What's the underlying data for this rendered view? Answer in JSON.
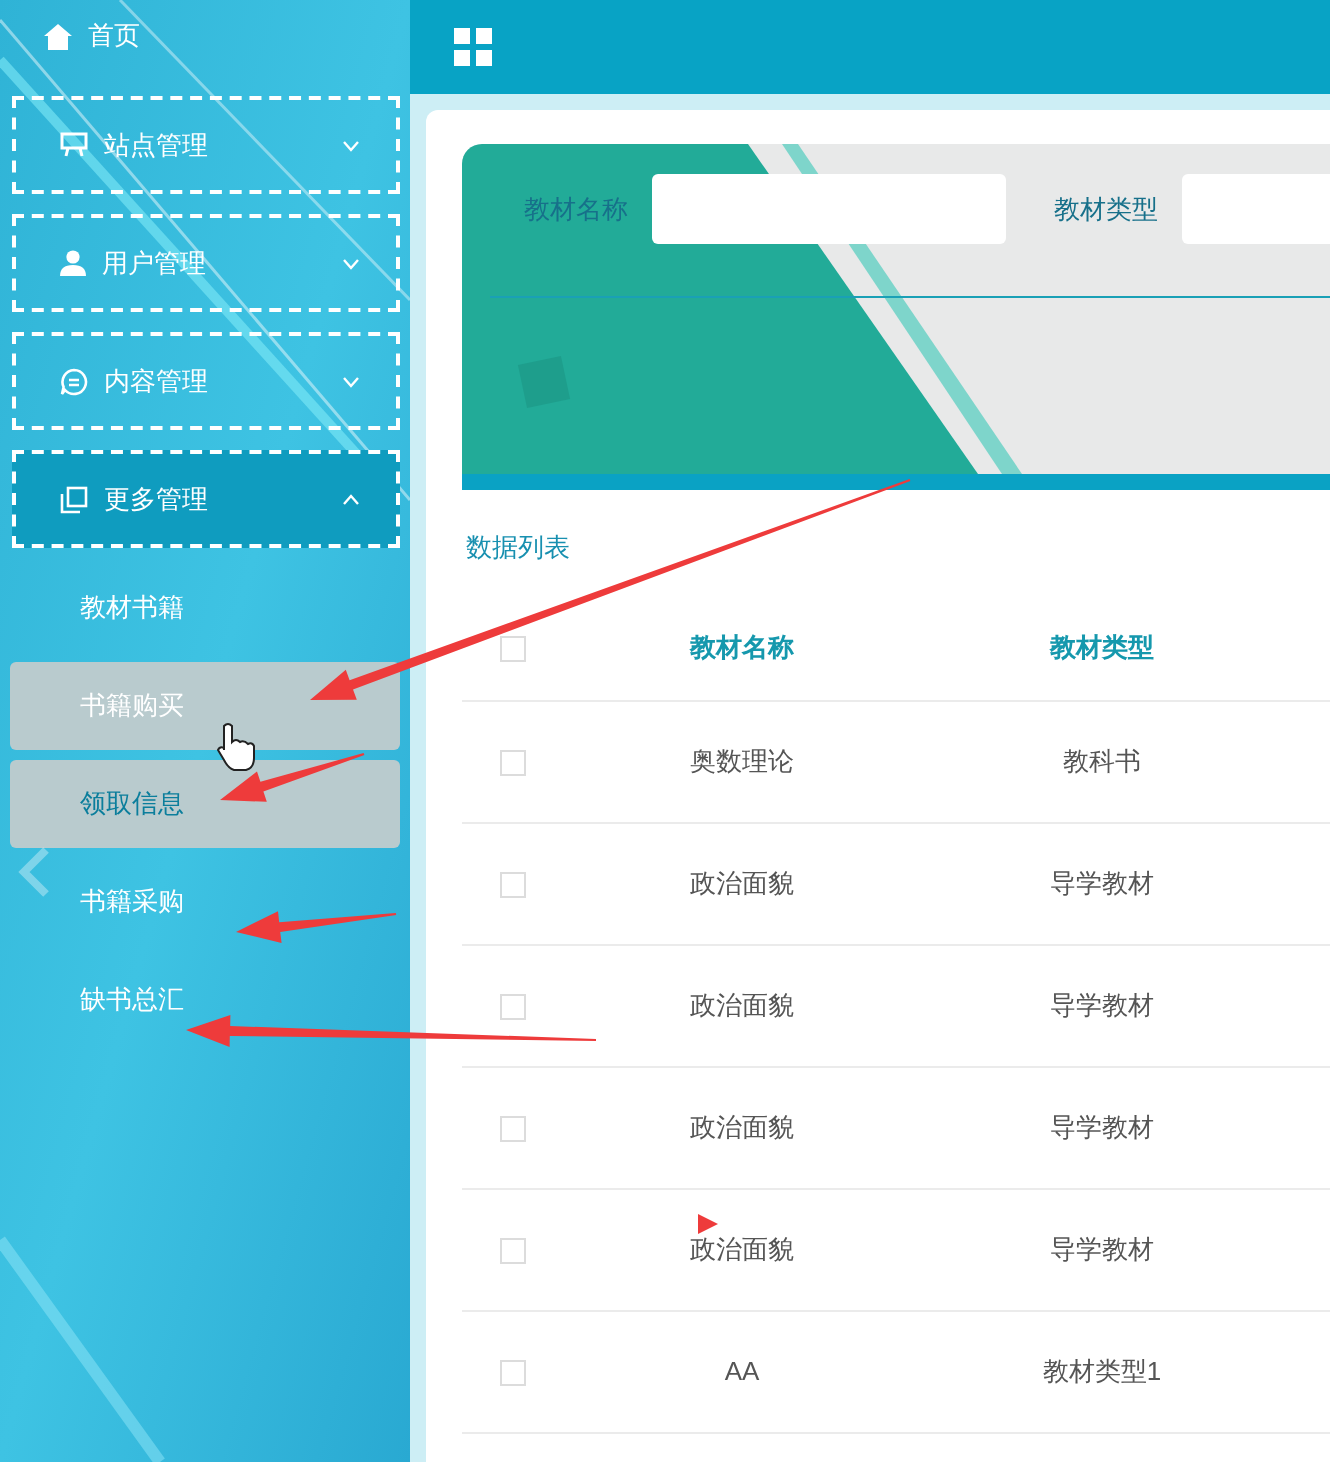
{
  "sidebar": {
    "menu": [
      {
        "label": "首页",
        "kind": "link"
      },
      {
        "label": "站点管理",
        "kind": "group",
        "expanded": false
      },
      {
        "label": "用户管理",
        "kind": "group",
        "expanded": false
      },
      {
        "label": "内容管理",
        "kind": "group",
        "expanded": false
      },
      {
        "label": "更多管理",
        "kind": "group",
        "expanded": true,
        "children": [
          {
            "label": "教材书籍",
            "highlighted": false,
            "selected": false
          },
          {
            "label": "书籍购买",
            "highlighted": true,
            "selected": false
          },
          {
            "label": "领取信息",
            "highlighted": true,
            "selected": true
          },
          {
            "label": "书籍采购",
            "highlighted": false,
            "selected": false
          },
          {
            "label": "缺书总汇",
            "highlighted": false,
            "selected": false
          }
        ]
      }
    ]
  },
  "search": {
    "fields": [
      {
        "label": "教材名称"
      },
      {
        "label": "教材类型"
      }
    ]
  },
  "table": {
    "title": "数据列表",
    "columns": [
      "教材名称",
      "教材类型"
    ],
    "header_checked": false,
    "rows": [
      {
        "cells": [
          "奥数理论",
          "教科书"
        ],
        "checked": false
      },
      {
        "cells": [
          "政治面貌",
          "导学教材"
        ],
        "checked": false
      },
      {
        "cells": [
          "政治面貌",
          "导学教材"
        ],
        "checked": false
      },
      {
        "cells": [
          "政治面貌",
          "导学教材"
        ],
        "checked": false
      },
      {
        "cells": [
          "政治面貌",
          "导学教材"
        ],
        "checked": false
      },
      {
        "cells": [
          "AA",
          "教材类型1"
        ],
        "checked": false
      }
    ]
  }
}
